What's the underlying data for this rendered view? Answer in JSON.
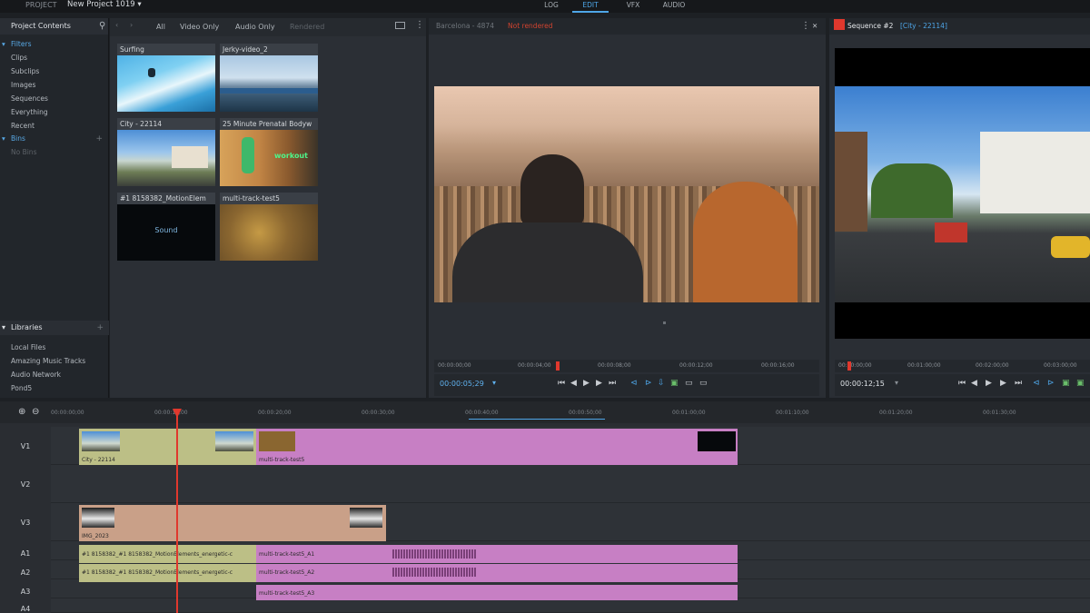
{
  "topbar": {
    "project_label": "PROJECT",
    "project_name": "New Project 1019 ▾",
    "tabs": [
      "LOG",
      "EDIT",
      "VFX",
      "AUDIO"
    ],
    "active_tab": "EDIT"
  },
  "left": {
    "header": "Project Contents",
    "filters_label": "Filters",
    "filter_items": [
      "Clips",
      "Subclips",
      "Images",
      "Sequences",
      "Everything",
      "Recent"
    ],
    "bins_label": "Bins",
    "bins_empty": "No Bins",
    "libraries_label": "Libraries",
    "library_items": [
      "Local Files",
      "Amazing Music Tracks",
      "Audio Network",
      "Pond5"
    ]
  },
  "bin": {
    "filters": [
      "All",
      "Video Only",
      "Audio Only",
      "Rendered"
    ],
    "clips": [
      {
        "name": "Surfing"
      },
      {
        "name": "Jerky-video_2"
      },
      {
        "name": "City - 22114"
      },
      {
        "name": "25 Minute Prenatal Bodyw"
      },
      {
        "name": "#1 8158382_MotionElem"
      },
      {
        "name": "multi-track-test5"
      }
    ],
    "sound_label": "Sound",
    "workout_text": "workout"
  },
  "source": {
    "title": "Barcelona - 4874",
    "status": "Not rendered",
    "ruler_ticks": [
      "00:00:00;00",
      "00:00:04;00",
      "00:00:08;00",
      "00:00:12;00",
      "00:00:16;00"
    ],
    "timecode": "00:00:05;29"
  },
  "record": {
    "title": "Sequence #2",
    "subtitle": "[City - 22114]",
    "ruler_ticks": [
      "00:00:00;00",
      "00:01:00;00",
      "00:02:00;00",
      "00:03:00;00"
    ],
    "timecode": "00:00:12;15"
  },
  "timeline": {
    "ruler_ticks": [
      "00:00:00;00",
      "00:00:10;00",
      "00:00:20;00",
      "00:00:30;00",
      "00:00:40;00",
      "00:00:50;00",
      "00:01:00;00",
      "00:01:10;00",
      "00:01:20;00",
      "00:01:30;00"
    ],
    "tracks": [
      "V1",
      "V2",
      "V3",
      "A1",
      "A2",
      "A3",
      "A4"
    ],
    "v1_clip_a": "City - 22114",
    "v1_clip_b": "multi-track-test5",
    "v3_clip": "IMG_2023",
    "a1_left": "#1 8158382_#1 8158382_MotionElements_energetic-c",
    "a1_right": "multi-track-test5_A1",
    "a2_left": "#1 8158382_#1 8158382_MotionElements_energetic-c",
    "a2_right": "multi-track-test5_A2",
    "a3_right": "multi-track-test5_A3"
  },
  "colors": {
    "accent": "#4ea6e8",
    "olive_clip": "#bcbf86",
    "pink_clip": "#c77fc4",
    "tan_clip": "#c9a088",
    "playhead": "#e0382d"
  }
}
